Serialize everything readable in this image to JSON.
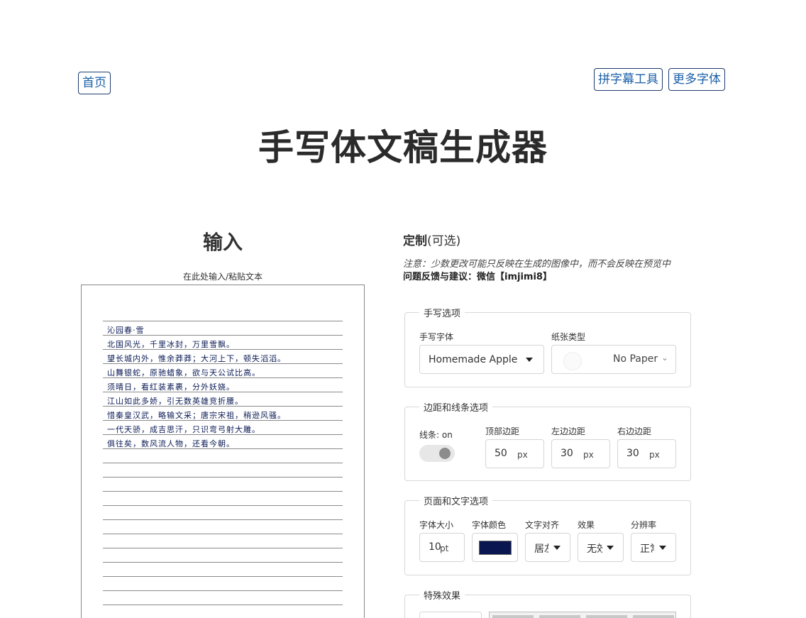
{
  "nav": {
    "home": "首页",
    "subtitle_tool": "拼字幕工具",
    "more_fonts": "更多字体"
  },
  "title": "手写体文稿生成器",
  "input": {
    "heading": "输入",
    "hint": "在此处输入/粘贴文本",
    "lines": [
      "沁园春·雪",
      "北国风光，千里冰封，万里雪飘。",
      "望长城内外，惟余莽莽；大河上下，顿失滔滔。",
      "山舞银蛇，原驰蜡象，欲与天公试比高。",
      "须晴日，看红装素裹，分外妖娆。",
      "江山如此多娇，引无数英雄竞折腰。",
      "惜秦皇汉武，略输文采；唐宗宋祖，稍逊风骚。",
      "一代天骄，成吉思汗，只识弯弓射大雕。",
      "俱往矣，数风流人物，还看今朝。"
    ]
  },
  "customize": {
    "title_bold": "定制",
    "title_optional": "(可选)",
    "note": "注意：少数更改可能只反映在生成的图像中，而不会反映在预览中",
    "feedback": "问题反馈与建议：微信【imjimi8】"
  },
  "handwriting": {
    "legend": "手写选项",
    "font_label": "手写字体",
    "font_value": "Homemade Apple",
    "paper_label": "纸张类型",
    "paper_value": "No Paper"
  },
  "margins": {
    "legend": "边距和线条选项",
    "lines_label": "线条: on",
    "top_label": "顶部边距",
    "top_value": "50",
    "left_label": "左边边距",
    "left_value": "30",
    "right_label": "右边边距",
    "right_value": "30",
    "unit": "px"
  },
  "page_text": {
    "legend": "页面和文字选项",
    "size_label": "字体大小",
    "size_value": "10",
    "size_unit": "pt",
    "color_label": "字体颜色",
    "color_value": "#0a1650",
    "align_label": "文字对齐",
    "align_value": "居左",
    "effect_label": "效果",
    "effect_value": "无效果",
    "resolution_label": "分辨率",
    "resolution_value": "正常"
  },
  "special": {
    "legend": "特殊效果"
  }
}
